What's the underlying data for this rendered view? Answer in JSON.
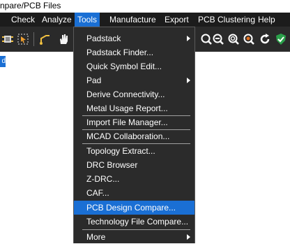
{
  "window": {
    "title": "npare/PCB Files"
  },
  "menubar": {
    "items": [
      {
        "label": "Check"
      },
      {
        "label": "Analyze"
      },
      {
        "label": "Tools"
      },
      {
        "label": "Manufacture"
      },
      {
        "label": "Export"
      },
      {
        "label": "PCB Clustering"
      },
      {
        "label": "Help"
      }
    ],
    "active": "Tools"
  },
  "toolbar": {
    "icons": [
      "chip-icon",
      "select-icon",
      "route-icon",
      "hand-icon",
      "zoom-in-icon",
      "zoom-out-icon",
      "zoom-fit-icon",
      "zoom-point-icon",
      "refresh-icon",
      "shield-icon"
    ]
  },
  "left_button": {
    "label": "d"
  },
  "tools_menu": {
    "items": [
      {
        "label": "Padstack",
        "submenu": true
      },
      {
        "label": "Padstack Finder..."
      },
      {
        "label": "Quick Symbol Edit..."
      },
      {
        "label": "Pad",
        "submenu": true
      },
      {
        "label": "Derive Connectivity..."
      },
      {
        "label": "Metal Usage Report..."
      },
      {
        "label": "Import File Manager..."
      },
      {
        "label": "MCAD Collaboration..."
      },
      {
        "label": "Topology Extract..."
      },
      {
        "label": "DRC Browser"
      },
      {
        "label": "Z-DRC..."
      },
      {
        "label": "CAF..."
      },
      {
        "label": "PCB Design Compare..."
      },
      {
        "label": "Technology File Compare..."
      },
      {
        "label": "More",
        "submenu": true
      }
    ],
    "highlighted": "PCB Design Compare..."
  }
}
